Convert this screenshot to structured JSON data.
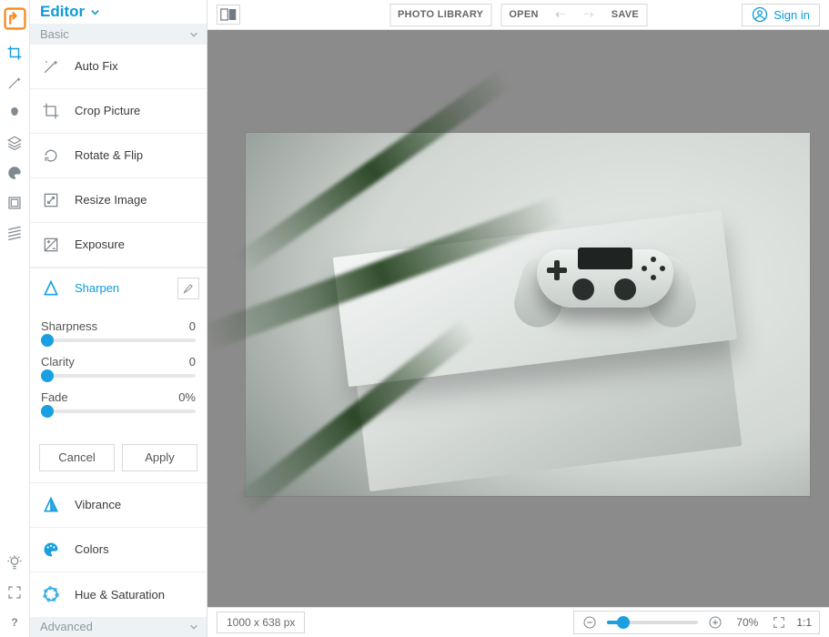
{
  "header": {
    "app_mode": "Editor"
  },
  "topbar": {
    "photo_library": "PHOTO LIBRARY",
    "open": "OPEN",
    "save": "SAVE",
    "sign_in": "Sign in"
  },
  "sidebar": {
    "groups": {
      "basic": "Basic",
      "advanced": "Advanced"
    },
    "items": {
      "auto_fix": "Auto Fix",
      "crop": "Crop Picture",
      "rotate_flip": "Rotate & Flip",
      "resize": "Resize Image",
      "exposure": "Exposure",
      "sharpen": "Sharpen",
      "vibrance": "Vibrance",
      "colors": "Colors",
      "hue_saturation": "Hue & Saturation"
    },
    "actions": {
      "cancel": "Cancel",
      "apply": "Apply"
    }
  },
  "sharpen_panel": {
    "sliders": [
      {
        "label": "Sharpness",
        "value": "0"
      },
      {
        "label": "Clarity",
        "value": "0"
      },
      {
        "label": "Fade",
        "value": "0%"
      }
    ]
  },
  "status": {
    "dimensions": "1000 x 638 px",
    "zoom_pct": "70%",
    "one_to_one": "1:1"
  },
  "colors": {
    "accent": "#1aa0e0",
    "brand_orange": "#f58a1f"
  }
}
